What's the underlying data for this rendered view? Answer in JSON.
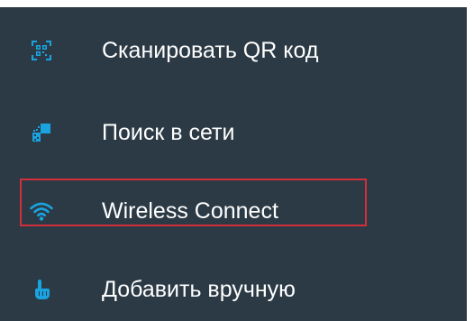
{
  "menu": {
    "items": [
      {
        "label": "Сканировать QR код",
        "icon": "qr-scan-icon"
      },
      {
        "label": "Поиск в сети",
        "icon": "network-search-icon"
      },
      {
        "label": "Wireless Connect",
        "icon": "wifi-icon",
        "highlighted": true
      },
      {
        "label": "Добавить вручную",
        "icon": "hand-pointer-icon"
      }
    ]
  },
  "colors": {
    "background": "#2b3a45",
    "accent": "#1aa3e0",
    "text": "#ffffff",
    "highlight_border": "#d32f3a"
  }
}
